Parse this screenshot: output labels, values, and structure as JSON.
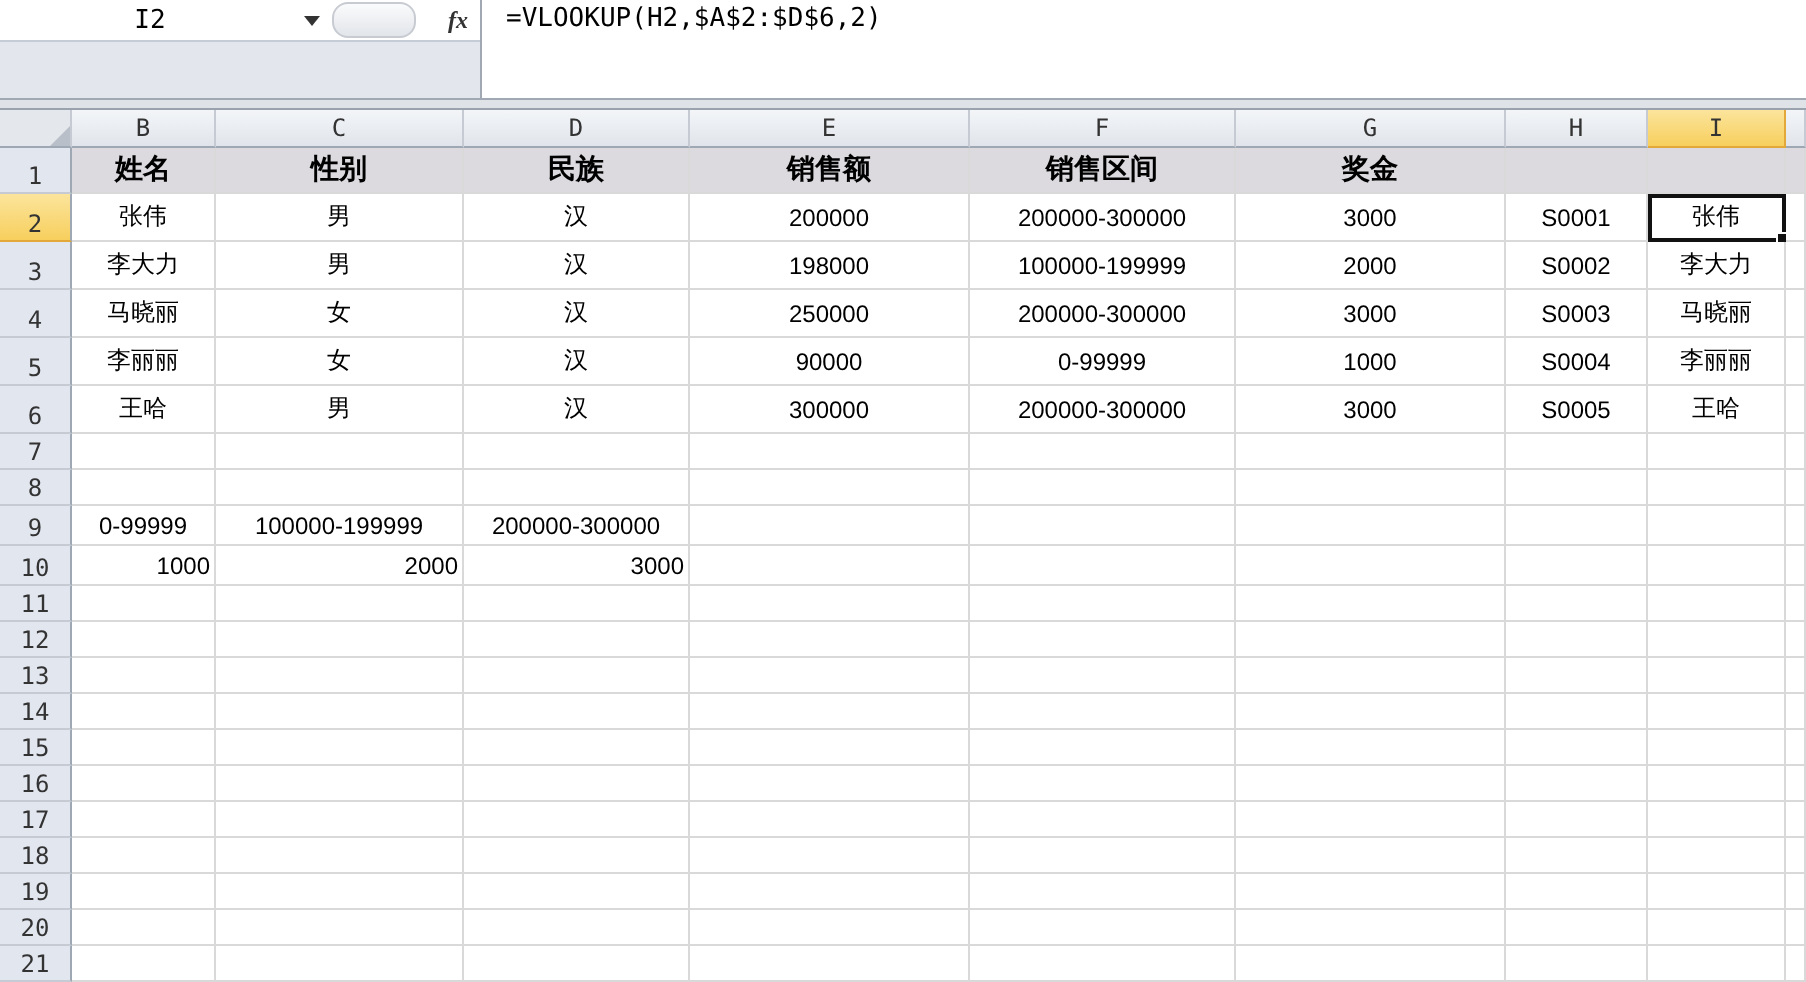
{
  "name_box": "I2",
  "function_label": "fx",
  "formula": "=VLOOKUP(H2,$A$2:$D$6,2)",
  "columns": [
    {
      "label": "B",
      "selected": false
    },
    {
      "label": "C",
      "selected": false
    },
    {
      "label": "D",
      "selected": false
    },
    {
      "label": "E",
      "selected": false
    },
    {
      "label": "F",
      "selected": false
    },
    {
      "label": "G",
      "selected": false
    },
    {
      "label": "H",
      "selected": false
    },
    {
      "label": "I",
      "selected": true
    }
  ],
  "rows": [
    {
      "number": "1",
      "kind": "header",
      "selected": false,
      "cells": [
        "姓名",
        "性别",
        "民族",
        "销售额",
        "销售区间",
        "奖金",
        null,
        null
      ]
    },
    {
      "number": "2",
      "kind": "data",
      "selected": true,
      "cells": [
        "张伟",
        "男",
        "汉",
        "200000",
        "200000-300000",
        "3000",
        "S0001",
        "张伟"
      ]
    },
    {
      "number": "3",
      "kind": "data",
      "selected": false,
      "cells": [
        "李大力",
        "男",
        "汉",
        "198000",
        "100000-199999",
        "2000",
        "S0002",
        "李大力"
      ]
    },
    {
      "number": "4",
      "kind": "data",
      "selected": false,
      "cells": [
        "马晓丽",
        "女",
        "汉",
        "250000",
        "200000-300000",
        "3000",
        "S0003",
        "马晓丽"
      ]
    },
    {
      "number": "5",
      "kind": "data",
      "selected": false,
      "cells": [
        "李丽丽",
        "女",
        "汉",
        "90000",
        "0-99999",
        "1000",
        "S0004",
        "李丽丽"
      ]
    },
    {
      "number": "6",
      "kind": "data",
      "selected": false,
      "cells": [
        "王哈",
        "男",
        "汉",
        "300000",
        "200000-300000",
        "3000",
        "S0005",
        "王哈"
      ]
    },
    {
      "number": "7",
      "kind": "blank",
      "selected": false
    },
    {
      "number": "8",
      "kind": "blank",
      "selected": false
    },
    {
      "number": "9",
      "kind": "range",
      "selected": false,
      "cells": [
        "0-99999",
        "100000-199999",
        "200000-300000",
        null,
        null,
        null,
        null,
        null
      ]
    },
    {
      "number": "10",
      "kind": "amount",
      "selected": false,
      "cells": [
        "1000",
        "2000",
        "3000",
        null,
        null,
        null,
        null,
        null
      ]
    },
    {
      "number": "11",
      "kind": "blank",
      "selected": false
    },
    {
      "number": "12",
      "kind": "blank",
      "selected": false
    },
    {
      "number": "13",
      "kind": "blank",
      "selected": false
    },
    {
      "number": "14",
      "kind": "blank",
      "selected": false
    },
    {
      "number": "15",
      "kind": "blank",
      "selected": false
    },
    {
      "number": "16",
      "kind": "blank",
      "selected": false
    },
    {
      "number": "17",
      "kind": "blank",
      "selected": false
    },
    {
      "number": "18",
      "kind": "blank",
      "selected": false
    },
    {
      "number": "19",
      "kind": "blank",
      "selected": false
    },
    {
      "number": "20",
      "kind": "blank",
      "selected": false
    },
    {
      "number": "21",
      "kind": "blank",
      "selected": false
    }
  ]
}
